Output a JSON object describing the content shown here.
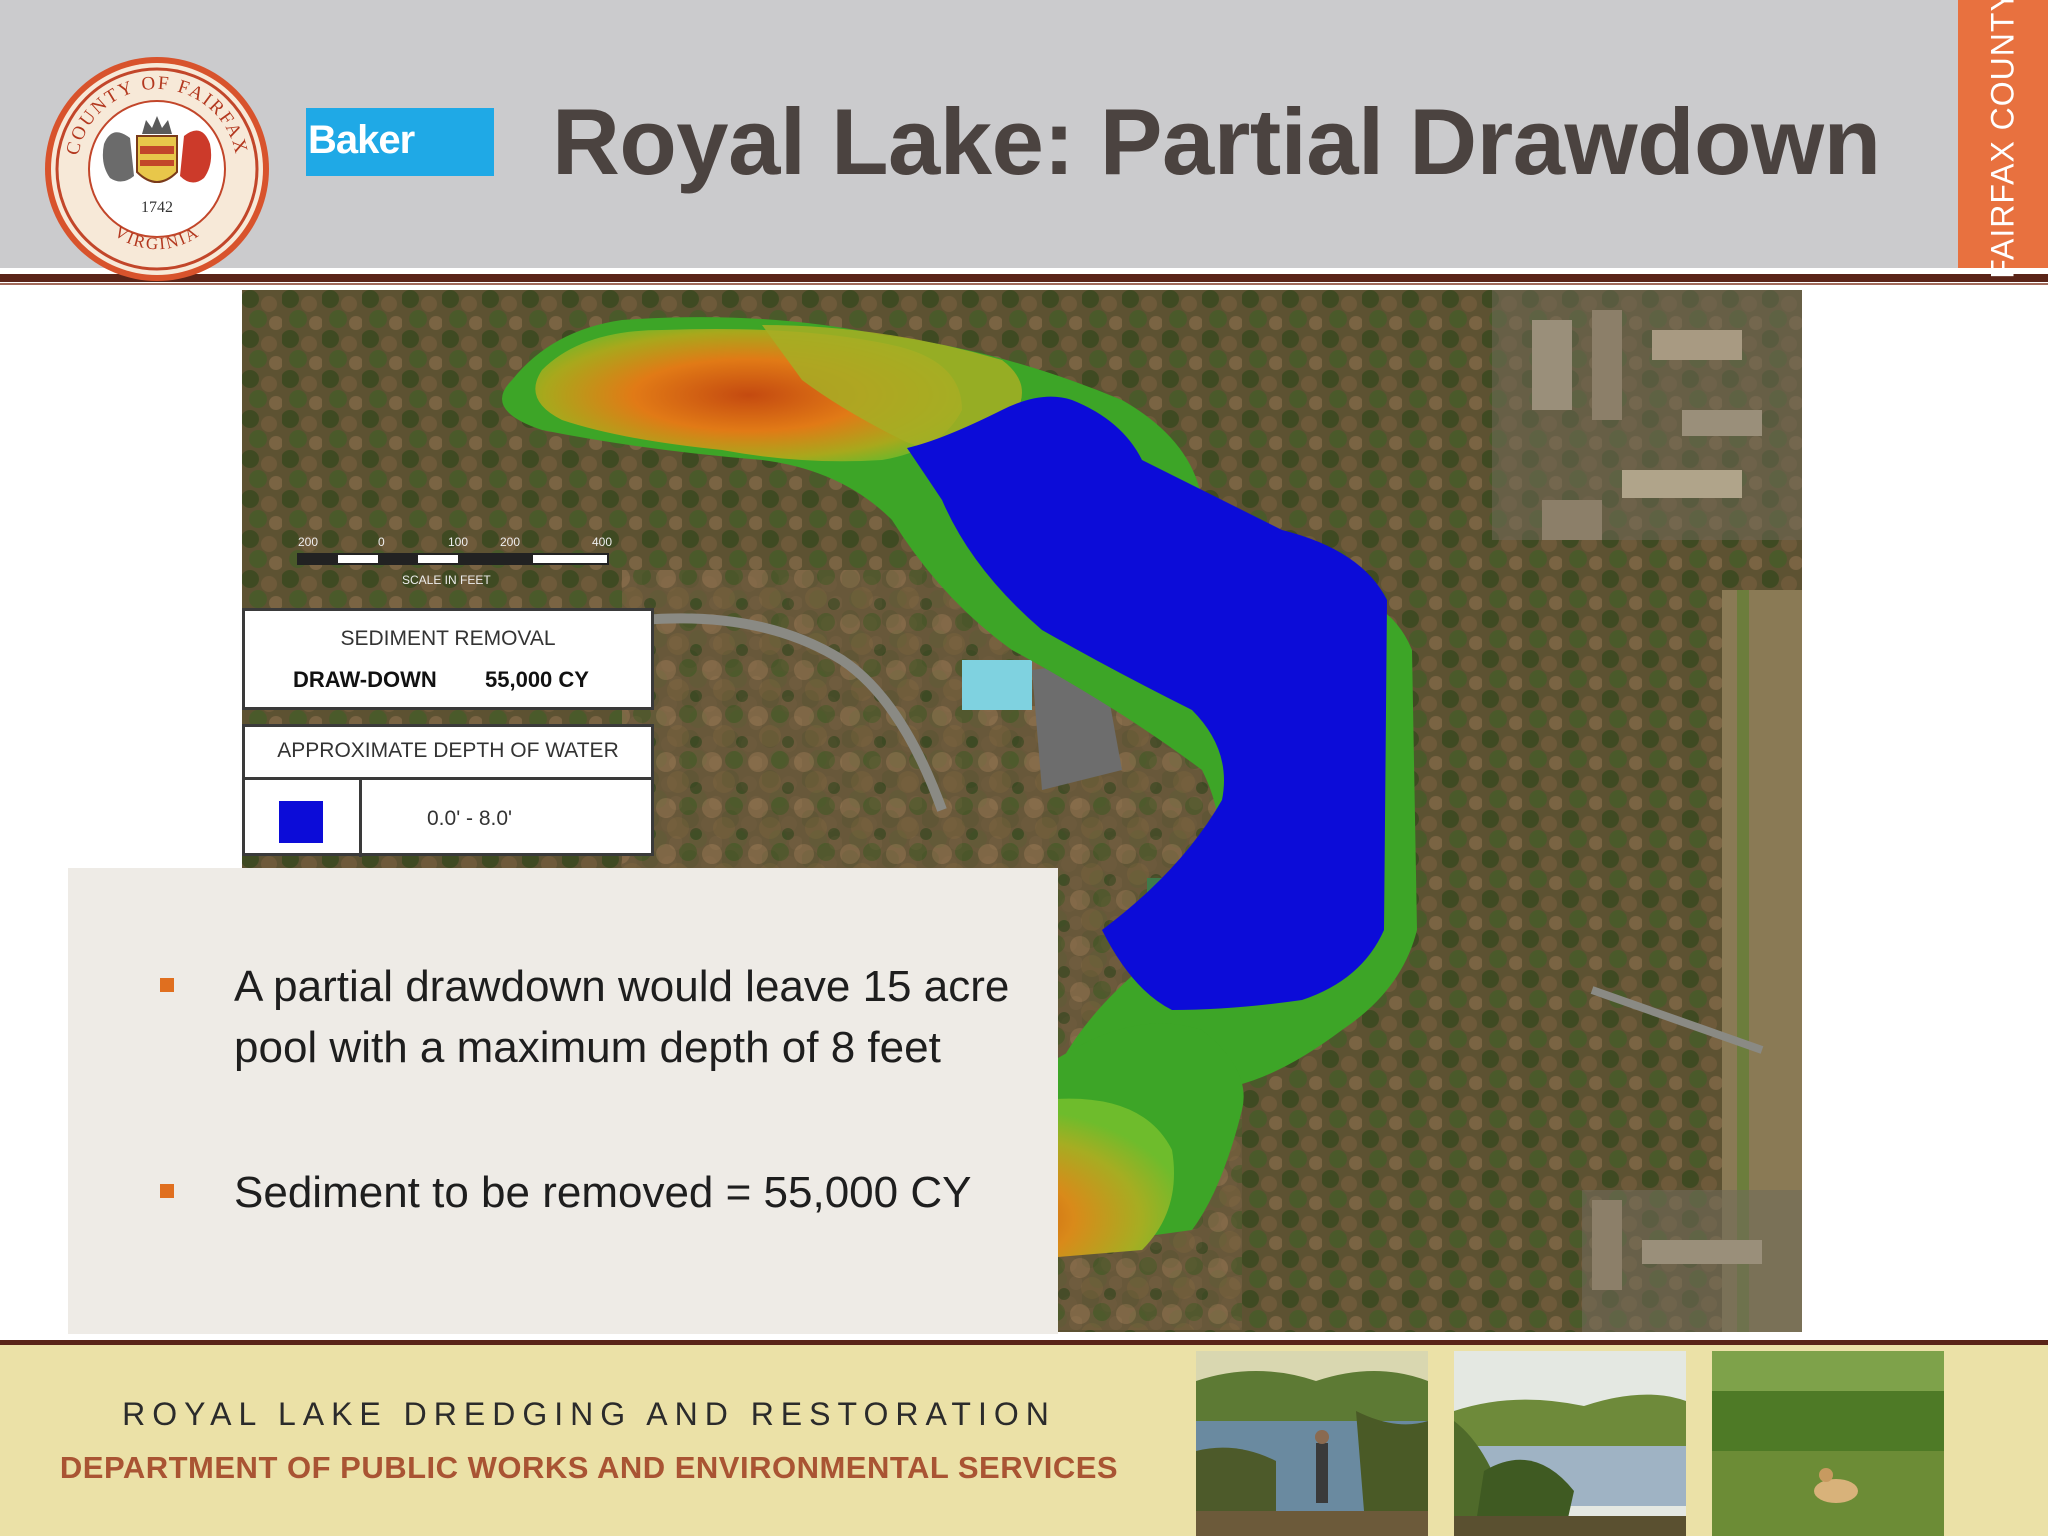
{
  "header": {
    "title": "Royal Lake: Partial Drawdown",
    "baker_logo_text": "Baker",
    "side_tab_text": "FAIRFAX COUNTY",
    "seal": {
      "top_text": "COUNTY OF FAIRFAX",
      "bottom_text": "VIRGINIA",
      "year": "1742"
    }
  },
  "legend": {
    "removal_heading": "SEDIMENT REMOVAL",
    "removal_label": "DRAW-DOWN",
    "removal_value": "55,000 CY",
    "depth_heading": "APPROXIMATE DEPTH OF WATER",
    "depth_range": "0.0' - 8.0'",
    "depth_color": "#0c0cd8"
  },
  "scale_bar": {
    "ticks": [
      "200",
      "0",
      "100",
      "200",
      "400"
    ],
    "label": "SCALE IN FEET"
  },
  "bullets": [
    "A partial drawdown would leave 15 acre pool with a maximum depth of 8 feet",
    "Sediment to be removed = 55,000 CY"
  ],
  "footer": {
    "line1": "ROYAL LAKE DREDGING AND RESTORATION",
    "line2": "DEPARTMENT OF PUBLIC WORKS AND ENVIRONMENTAL SERVICES"
  },
  "colors": {
    "accent_orange": "#e8713f",
    "header_gray": "#cbcbcd",
    "water_blue": "#0c0cd8",
    "footer_yellow": "#ebe1a7",
    "bullet_orange": "#e06f1f"
  }
}
